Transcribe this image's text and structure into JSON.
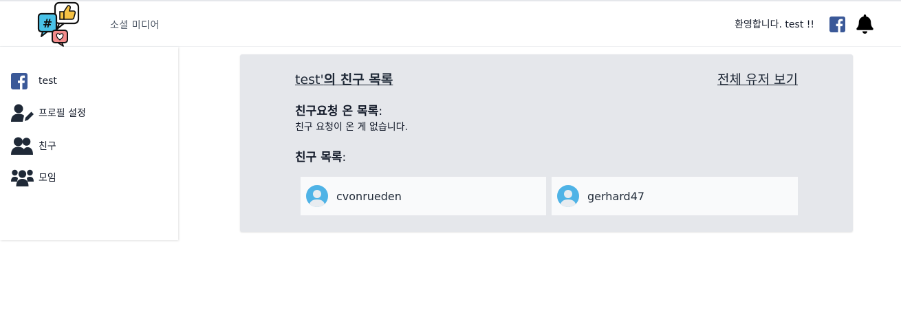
{
  "header": {
    "brand": "소셜 미디어",
    "welcome": "환영합니다. test !!"
  },
  "sidebar": {
    "items": [
      {
        "label": "test",
        "icon": "facebook-icon"
      },
      {
        "label": "프로필 설정",
        "icon": "user-edit-icon"
      },
      {
        "label": "친구",
        "icon": "user-friends-icon"
      },
      {
        "label": "모임",
        "icon": "users-group-icon"
      }
    ]
  },
  "main": {
    "title_name": "test'",
    "title_rest": "의 친구 목록",
    "all_users_link": "전체 유저 보기",
    "requests_heading": "친구요청 온 목록",
    "requests_empty": "친구 요청이 온 게 없습니다.",
    "friends_heading": "친구 목록",
    "colon": ":",
    "friends": [
      {
        "name": "cvonrueden"
      },
      {
        "name": "gerhard47"
      }
    ]
  },
  "colors": {
    "facebook": "#3b5998",
    "panel_bg": "#e5e7eb",
    "card_bg": "#f9fafb",
    "avatar_blue": "#4fb3e6"
  }
}
